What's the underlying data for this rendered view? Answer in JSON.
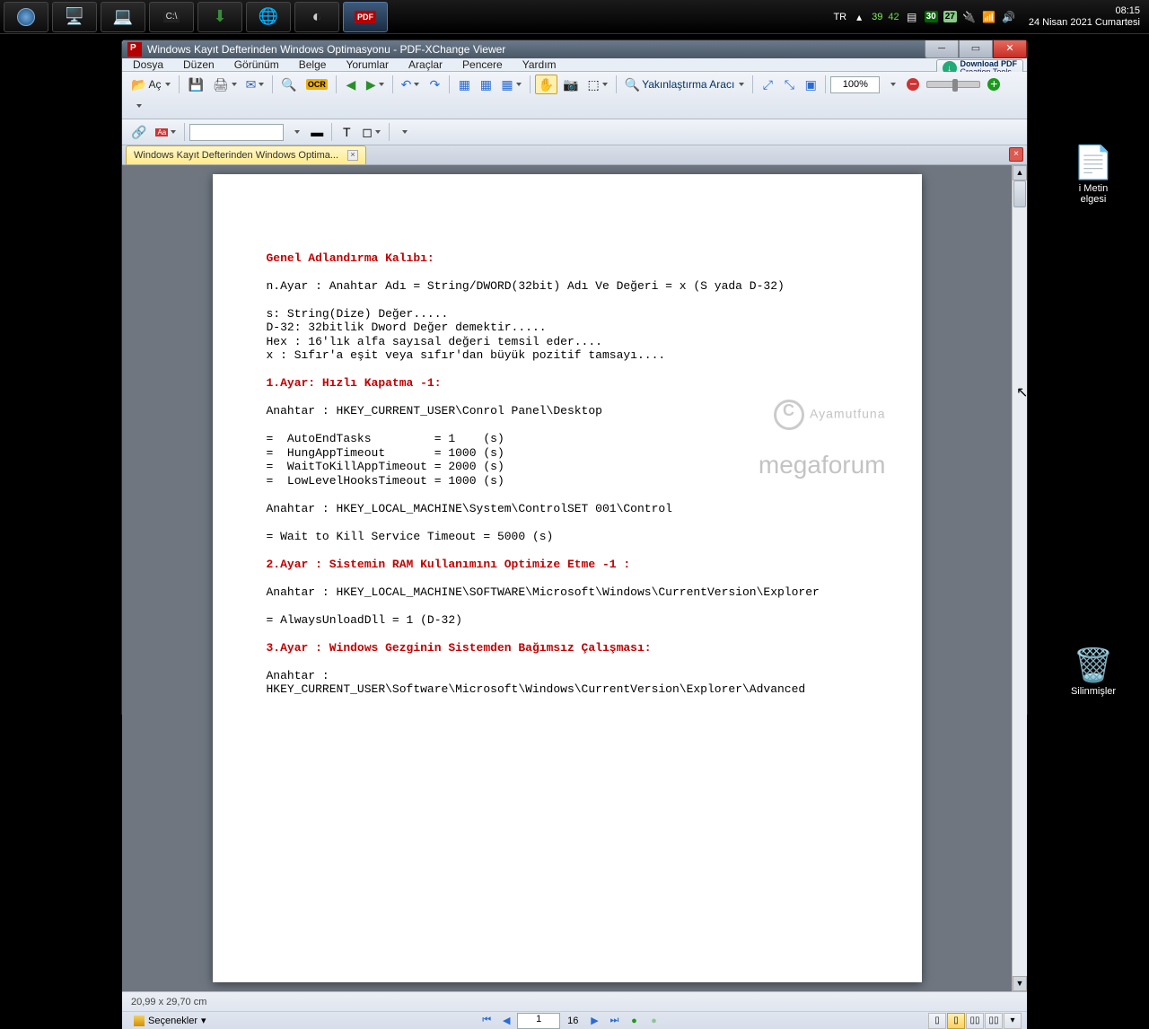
{
  "taskbar": {
    "lang": "TR",
    "num1": "39",
    "num2": "42",
    "num3": "30",
    "num4": "27",
    "time": "08:15",
    "date": "24 Nisan 2021 Cumartesi"
  },
  "desktop": {
    "icon1_label": "i Metin\nelgesi",
    "icon2_label": "Silinmişler"
  },
  "window": {
    "title": "Windows Kayıt Defterinden Windows Optimasyonu - PDF-XChange Viewer",
    "download_line1": "Download PDF",
    "download_line2": "Creation Tools"
  },
  "menu": {
    "file": "Dosya",
    "edit": "Düzen",
    "view": "Görünüm",
    "document": "Belge",
    "comments": "Yorumlar",
    "tools": "Araçlar",
    "window": "Pencere",
    "help": "Yardım"
  },
  "toolbar": {
    "open": "Aç",
    "zoom_tool": "Yakınlaştırma Aracı",
    "zoom": "100%"
  },
  "tab": {
    "label": "Windows Kayıt Defterinden Windows Optima..."
  },
  "status": {
    "dims": "20,99 x 29,70 cm",
    "options": "Seçenekler",
    "page": "1",
    "total": "16"
  },
  "doc": {
    "h1": "Genel Adlandırma Kalıbı:",
    "p1": "n.Ayar : Anahtar Adı = String/DWORD(32bit) Adı Ve Değeri = x (S yada D-32)",
    "p2": "s: String(Dize) Değer.....\nD-32: 32bitlik Dword Değer demektir.....\nHex : 16'lık alfa sayısal değeri temsil eder....\nx : Sıfır'a eşit veya sıfır'dan büyük pozitif tamsayı....",
    "h2": "1.Ayar: Hızlı Kapatma -1:",
    "p3": "Anahtar : HKEY_CURRENT_USER\\Conrol Panel\\Desktop",
    "p4": "=  AutoEndTasks         = 1    (s)\n=  HungAppTimeout       = 1000 (s)\n=  WaitToKillAppTimeout = 2000 (s)\n=  LowLevelHooksTimeout = 1000 (s)",
    "p5": "Anahtar : HKEY_LOCAL_MACHINE\\System\\ControlSET 001\\Control",
    "p6": "= Wait to Kill Service Timeout = 5000 (s)",
    "h3": "2.Ayar : Sistemin RAM Kullanımını Optimize Etme -1 :",
    "p7": "Anahtar : HKEY_LOCAL_MACHINE\\SOFTWARE\\Microsoft\\Windows\\CurrentVersion\\Explorer",
    "p8": "= AlwaysUnloadDll = 1 (D-32)",
    "h4": "3.Ayar : Windows Gezginin Sistemden Bağımsız Çalışması:",
    "p9": "Anahtar :\nHKEY_CURRENT_USER\\Software\\Microsoft\\Windows\\CurrentVersion\\Explorer\\Advanced",
    "wm1": "Ayamutfuna",
    "wm2": "megaforum"
  }
}
